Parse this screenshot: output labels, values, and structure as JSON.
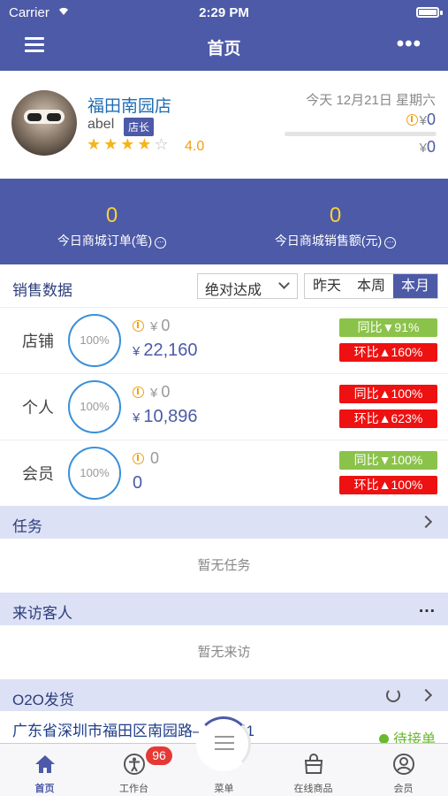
{
  "status_bar": {
    "carrier": "Carrier",
    "time": "2:29 PM"
  },
  "nav": {
    "title": "首页"
  },
  "store": {
    "name": "福田南园店",
    "user": "abel",
    "role": "店长",
    "rating": "4.0",
    "stars_filled": 4,
    "stars_total": 5,
    "date": "今天 12月21日 星期六",
    "money_top": "0",
    "money_bottom": "0",
    "currency": "¥",
    "progress": 0
  },
  "today": {
    "orders_value": "0",
    "orders_label": "今日商城订单(笔)",
    "sales_value": "0",
    "sales_label": "今日商城销售额(元)"
  },
  "sales": {
    "title": "销售数据",
    "filter": "绝对达成",
    "periods": [
      "昨天",
      "本周",
      "本月"
    ],
    "active_period": "本月",
    "rows": [
      {
        "label": "店铺",
        "percent": "100%",
        "line1": "0",
        "line2": "22,160",
        "yoy": "同比▼91%",
        "yoy_color": "green",
        "mom": "环比▲160%",
        "mom_color": "red",
        "line2_yen": true
      },
      {
        "label": "个人",
        "percent": "100%",
        "line1": "0",
        "line2": "10,896",
        "yoy": "同比▲100%",
        "yoy_color": "red",
        "mom": "环比▲623%",
        "mom_color": "red",
        "line2_yen": true
      },
      {
        "label": "会员",
        "percent": "100%",
        "line1": "0",
        "line2": "0",
        "yoy": "同比▼100%",
        "yoy_color": "green",
        "mom": "环比▲100%",
        "mom_color": "red",
        "line2_yen": false
      }
    ]
  },
  "tasks": {
    "title": "任务",
    "empty": "暂无任务"
  },
  "visitors": {
    "title": "来访客人",
    "empty": "暂无来访"
  },
  "o2o": {
    "title": "O2O发货",
    "address": "广东省深圳市福田区南园路——2路1",
    "status": "待接单"
  },
  "tabbar": {
    "items": [
      "首页",
      "工作台",
      "菜单",
      "在线商品",
      "会员"
    ],
    "badge": "96"
  }
}
